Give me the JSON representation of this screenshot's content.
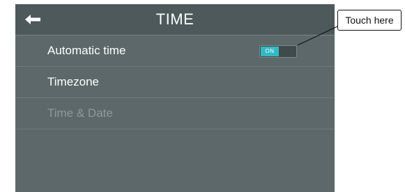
{
  "header": {
    "title": "TIME",
    "back_icon": "back-arrow-icon"
  },
  "settings": {
    "items": [
      {
        "label": "Automatic time",
        "toggle": {
          "state": "ON",
          "enabled": true
        }
      },
      {
        "label": "Timezone"
      },
      {
        "label": "Time & Date",
        "disabled": true
      }
    ]
  },
  "annotation": {
    "label": "Touch here"
  },
  "colors": {
    "screen_bg": "#5c6869",
    "header_bg": "#4d595a",
    "toggle_on": "#33b9c4"
  }
}
